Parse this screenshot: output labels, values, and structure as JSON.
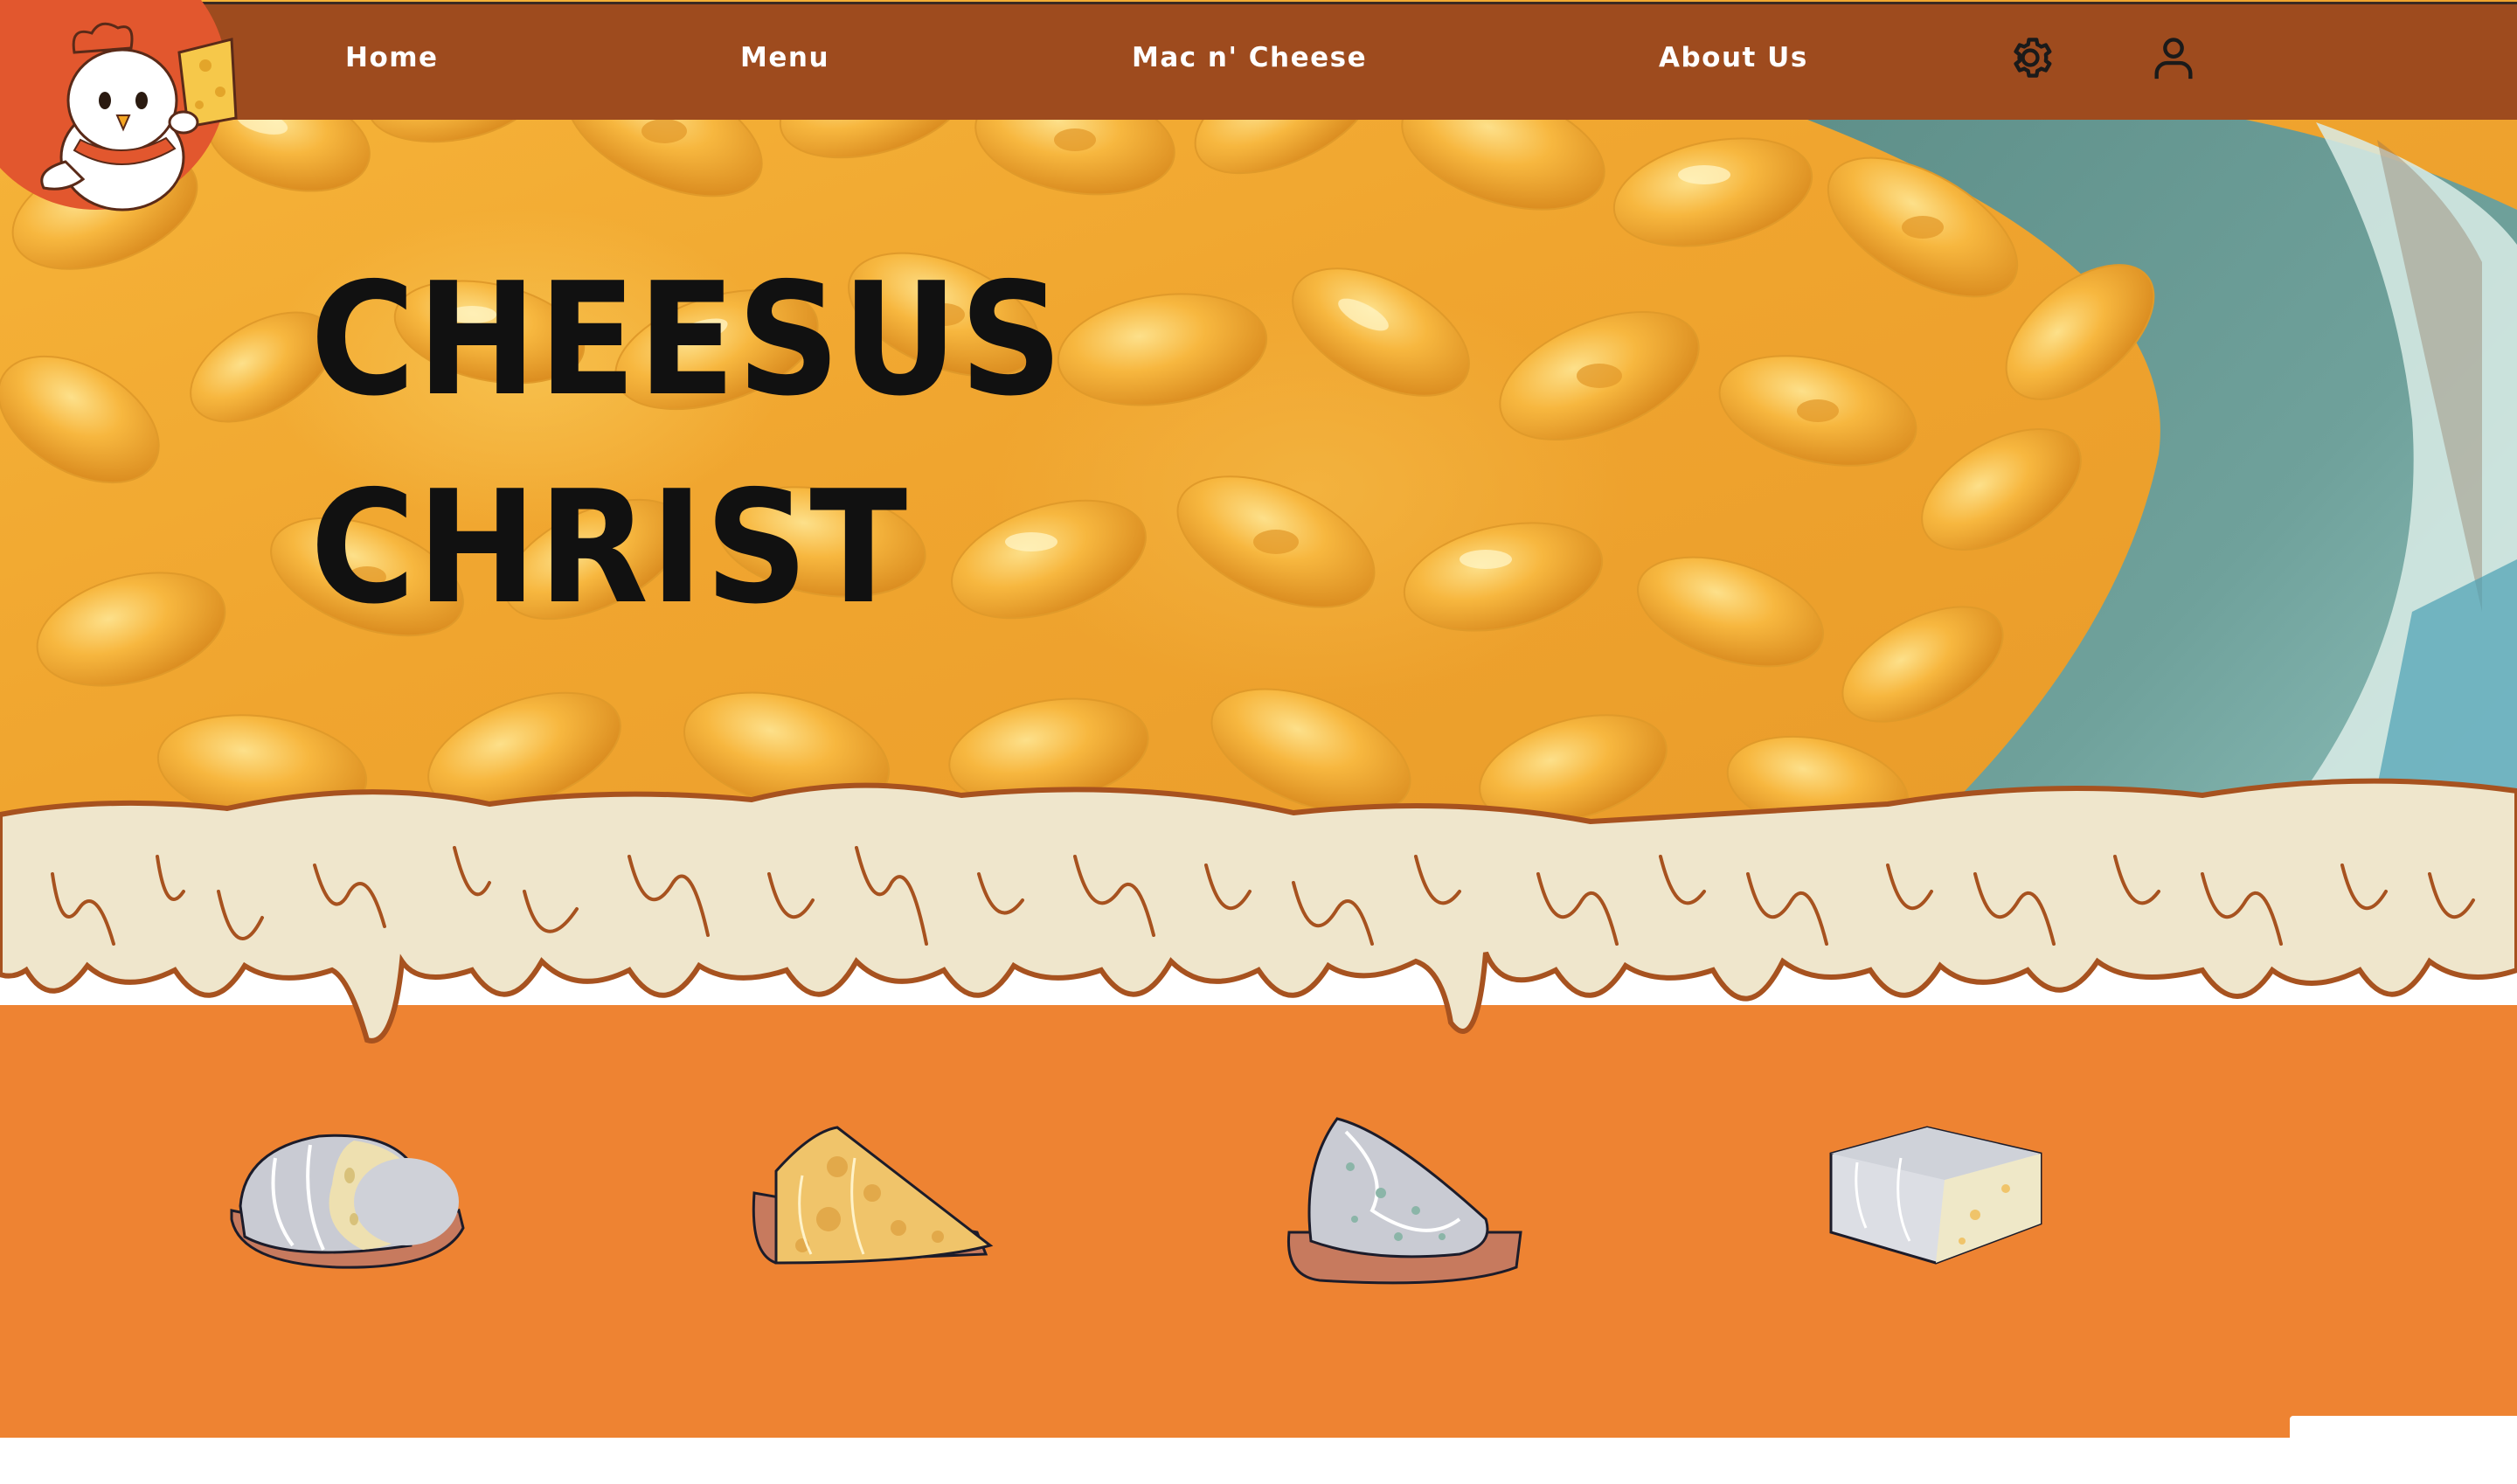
{
  "nav": {
    "items": [
      {
        "label": "Home"
      },
      {
        "label": "Menu"
      },
      {
        "label": "Mac n' Cheese"
      },
      {
        "label": "About Us"
      }
    ],
    "icons": [
      "gear-icon",
      "user-icon"
    ]
  },
  "hero": {
    "headline_line1": "CHEESUS",
    "headline_line2": "CHRIST"
  },
  "cheeses": [
    "round-cheese",
    "swiss-wedge",
    "blue-cheese-wedge",
    "feta-block"
  ],
  "colors": {
    "nav_bg": "#9e4b1e",
    "logo_badge": "#e2572e",
    "cheese_drip": "#efe6cc",
    "drip_outline": "#a7521f",
    "section_orange": "#ee8332",
    "headline": "#111111"
  }
}
